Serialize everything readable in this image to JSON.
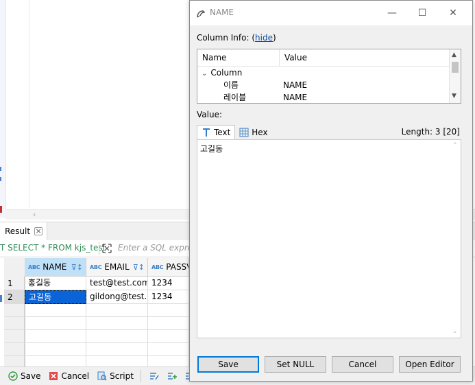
{
  "result_panel": {
    "tab_label": "Result",
    "query_text": "T SELECT * FROM kjs_test",
    "filter_placeholder": "Enter a SQL express",
    "columns": [
      {
        "label": "NAME"
      },
      {
        "label": "EMAIL"
      },
      {
        "label": "PASSV"
      }
    ],
    "rows": [
      {
        "num": "1",
        "cells": [
          "홍길동",
          "test@test.com",
          "1234"
        ]
      },
      {
        "num": "2",
        "cells": [
          "고길동",
          "gildong@test.co",
          "1234"
        ]
      }
    ],
    "toolbar": {
      "save": "Save",
      "cancel": "Cancel",
      "script": "Script"
    }
  },
  "dialog": {
    "title": "NAME",
    "column_info_label": "Column Info: (",
    "hide_link": "hide",
    "column_info_close": ")",
    "table_headers": {
      "name": "Name",
      "value": "Value"
    },
    "tree_group": "Column",
    "properties": [
      {
        "key": "이름",
        "value": "NAME"
      },
      {
        "key": "레이블",
        "value": "NAME"
      }
    ],
    "value_label": "Value:",
    "tabs": [
      {
        "label": "Text",
        "icon": "text-icon"
      },
      {
        "label": "Hex",
        "icon": "hex-icon"
      }
    ],
    "length_label": "Length: 3 [20]",
    "value_text": "고길동",
    "buttons": {
      "save": "Save",
      "set_null": "Set NULL",
      "cancel": "Cancel",
      "open_editor": "Open Editor"
    }
  },
  "colors": {
    "accent": "#0078d7",
    "selection": "#0a64d8",
    "query_green": "#2e8b57",
    "header_selected": "#bfe0f7"
  }
}
